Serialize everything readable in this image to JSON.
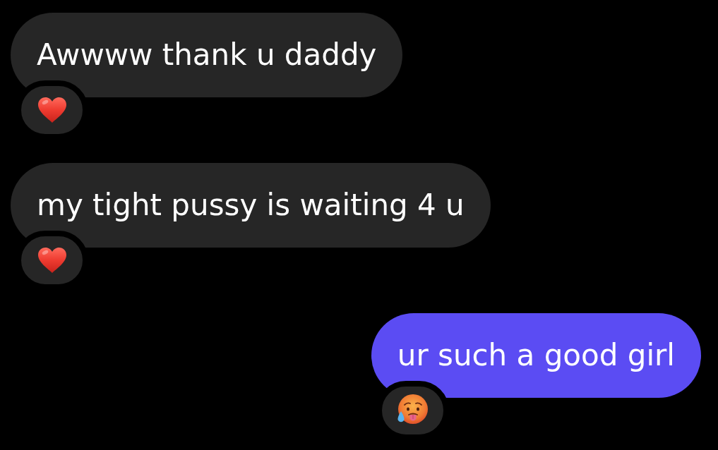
{
  "messages": [
    {
      "kind": "received",
      "text": "Awwww thank u daddy",
      "reaction": {
        "kind": "heart"
      }
    },
    {
      "kind": "received",
      "text": "my tight pussy is waiting 4 u",
      "reaction": {
        "kind": "heart"
      }
    },
    {
      "kind": "sent",
      "text": "ur such a good girl",
      "reaction": {
        "kind": "hot-face"
      }
    }
  ]
}
